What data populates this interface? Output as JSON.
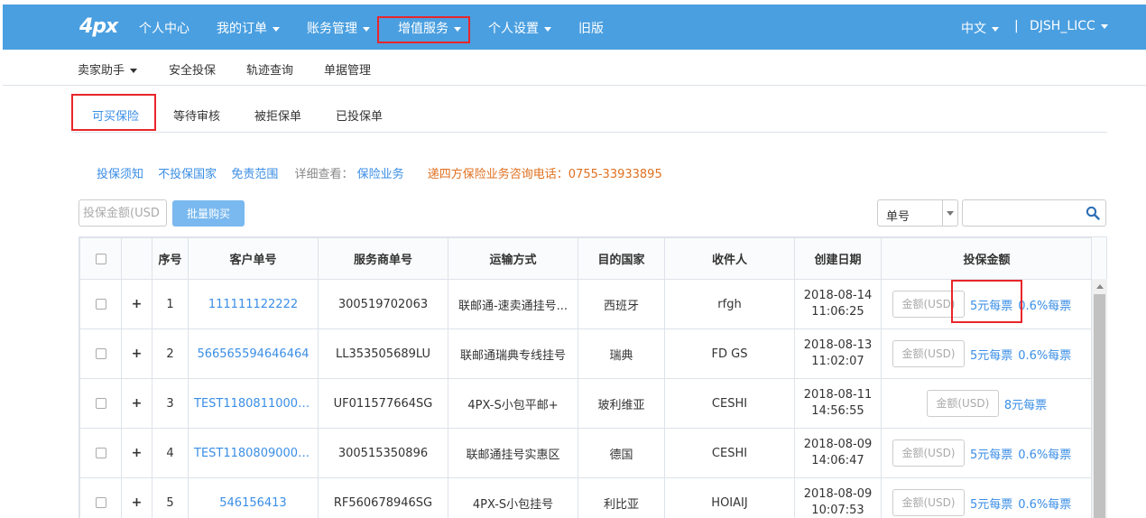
{
  "topnav": {
    "logo": "4px",
    "items": [
      "个人中心",
      "我的订单",
      "账务管理",
      "增值服务",
      "个人设置",
      "旧版"
    ],
    "lang": "中文",
    "user": "DJSH_LICC"
  },
  "subnav": {
    "items": [
      "卖家助手",
      "安全投保",
      "轨迹查询",
      "单据管理"
    ]
  },
  "tabs": [
    "可买保险",
    "等待审核",
    "被拒保单",
    "已投保单"
  ],
  "links": {
    "notice": "投保须知",
    "excluded": "不投保国家",
    "scope": "免责范围",
    "detail_label": "详细查看：",
    "business": "保险业务",
    "phone": "递四方保险业务咨询电话：0755-33933895"
  },
  "toolbar": {
    "amount_placeholder": "投保金额(USD",
    "batch_label": "批量购买",
    "select_value": "单号"
  },
  "table": {
    "headers": [
      "",
      "",
      "序号",
      "客户单号",
      "服务商单号",
      "运输方式",
      "目的国家",
      "收件人",
      "创建日期",
      "投保金额"
    ],
    "amount_placeholder": "金额(USD)",
    "rows": [
      {
        "seq": "1",
        "cust": "111111122222",
        "sp": "300519702063",
        "ship": "联邮通-速卖通挂号...",
        "country": "西班牙",
        "recv": "rfgh",
        "date": "2018-08-14",
        "time": "11:06:25",
        "rate1": "5元每票",
        "rate2": "0.6%每票"
      },
      {
        "seq": "2",
        "cust": "566565594646464",
        "sp": "LL353505689LU",
        "ship": "联邮通瑞典专线挂号",
        "country": "瑞典",
        "recv": "FD GS",
        "date": "2018-08-13",
        "time": "11:02:07",
        "rate1": "5元每票",
        "rate2": "0.6%每票"
      },
      {
        "seq": "3",
        "cust": "TEST11808110000...",
        "sp": "UF011577664SG",
        "ship": "4PX-S小包平邮+",
        "country": "玻利维亚",
        "recv": "CESHI",
        "date": "2018-08-11",
        "time": "14:56:55",
        "rate1": "8元每票",
        "rate2": ""
      },
      {
        "seq": "4",
        "cust": "TEST11808090000...",
        "sp": "300515350896",
        "ship": "联邮通挂号实惠区",
        "country": "德国",
        "recv": "CESHI",
        "date": "2018-08-09",
        "time": "14:06:47",
        "rate1": "5元每票",
        "rate2": "0.6%每票"
      },
      {
        "seq": "5",
        "cust": "546156413",
        "sp": "RF560678946SG",
        "ship": "4PX-S小包挂号",
        "country": "利比亚",
        "recv": "HOIAIJ",
        "date": "2018-08-09",
        "time": "10:07:53",
        "rate1": "5元每票",
        "rate2": "0.6%每票"
      }
    ]
  }
}
